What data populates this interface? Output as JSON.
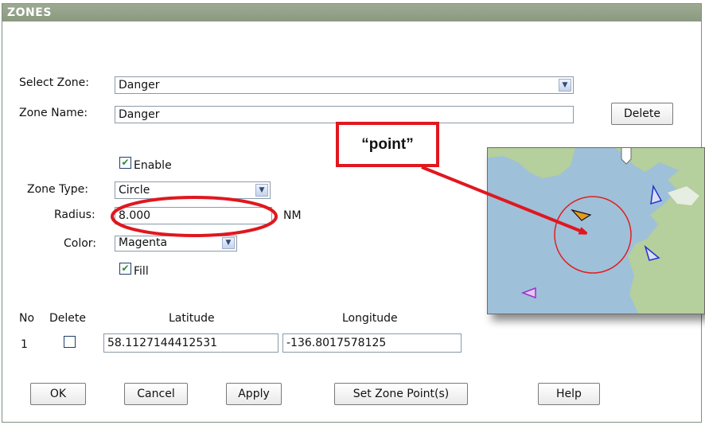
{
  "window": {
    "title": "ZONES"
  },
  "select_zone": {
    "label": "Select Zone:",
    "value": "Danger"
  },
  "zone_name": {
    "label": "Zone Name:",
    "value": "Danger"
  },
  "delete_button": "Delete",
  "enable": {
    "label": "Enable",
    "checked": true
  },
  "zone_type": {
    "label": "Zone Type:",
    "value": "Circle"
  },
  "radius": {
    "label": "Radius:",
    "value": "8.000",
    "unit": "NM"
  },
  "color": {
    "label": "Color:",
    "value": "Magenta"
  },
  "fill": {
    "label": "Fill",
    "checked": true
  },
  "points_table": {
    "headers": {
      "no": "No",
      "delete": "Delete",
      "latitude": "Latitude",
      "longitude": "Longitude"
    },
    "rows": [
      {
        "no": "1",
        "latitude": "58.1127144412531",
        "longitude": "-136.8017578125"
      }
    ]
  },
  "buttons": {
    "ok": "OK",
    "cancel": "Cancel",
    "apply": "Apply",
    "set_zone_points": "Set Zone Point(s)",
    "help": "Help"
  },
  "annotation": {
    "callout_text": "“point”",
    "color": "#e0171f"
  },
  "colors": {
    "titlebar": "#8f9e86",
    "water": "#9fc0d9",
    "land": "#b5cf9d",
    "zone_circle": "#e02020"
  },
  "icons": [
    "chevron-down-icon",
    "checkbox-icon",
    "vessel-icon"
  ]
}
